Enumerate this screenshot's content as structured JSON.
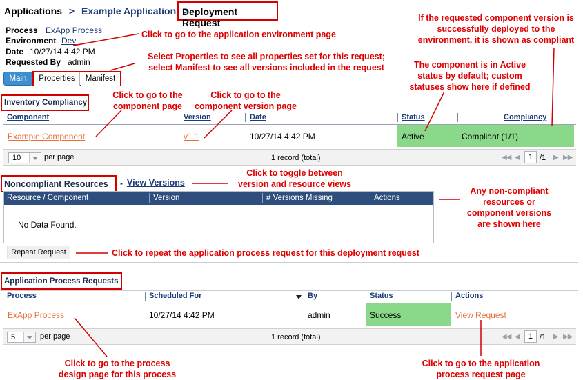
{
  "breadcrumb": {
    "applications": "Applications",
    "sep1": ">",
    "app": "Example Application",
    "sep2": ">",
    "current": "Deployment Request"
  },
  "details": {
    "process_label": "Process",
    "process_value": "ExApp Process",
    "environment_label": "Environment",
    "environment_value": "Dev",
    "date_label": "Date",
    "date_value": "10/27/14 4:42 PM",
    "requested_by_label": "Requested By",
    "requested_by_value": "admin"
  },
  "tabs": [
    {
      "label": "Main",
      "active": true
    },
    {
      "label": "Properties",
      "active": false
    },
    {
      "label": "Manifest",
      "active": false
    }
  ],
  "inventory": {
    "title": "Inventory Compliancy",
    "columns": [
      "Component",
      "Version",
      "Date",
      "Status",
      "Compliancy"
    ],
    "rows": [
      {
        "component": "Example Component",
        "version": "v1.1",
        "date": "10/27/14 4:42 PM",
        "status": "Active",
        "compliancy": "Compliant (1/1)"
      }
    ],
    "per_page_value": "10",
    "per_page_label": "per page",
    "record_count": "1 record (total)",
    "page_value": "1",
    "page_total": "/1"
  },
  "noncompliant": {
    "title": "Noncompliant Resources",
    "dash": "-",
    "view_versions": "View Versions",
    "columns": [
      "Resource / Component",
      "Version",
      "# Versions Missing",
      "Actions"
    ],
    "empty": "No Data Found."
  },
  "repeat_button": "Repeat Request",
  "process_requests": {
    "title": "Application Process Requests",
    "columns": [
      "Process",
      "Scheduled For",
      "By",
      "Status",
      "Actions"
    ],
    "rows": [
      {
        "process": "ExApp Process",
        "scheduled": "10/27/14 4:42 PM",
        "by": "admin",
        "status": "Success",
        "action": "View Request"
      }
    ],
    "per_page_value": "5",
    "per_page_label": "per page",
    "record_count": "1 record (total)",
    "page_value": "1",
    "page_total": "/1"
  },
  "annotations": {
    "env_page": "Click to go to the application environment page",
    "props": "Select Properties to see all properties set for this request;\nselect Manifest to see all versions included in the request",
    "compliant": "If the requested component version is\nsuccessfully deployed to the\nenvironment, it is shown as compliant",
    "active_status": "The component is in Active\nstatus by default; custom\nstatuses show here if defined",
    "component_page": "Click to go to the\ncomponent page",
    "version_page": "Click to go to the\ncomponent version page",
    "toggle": "Click to toggle between\nversion and resource views",
    "noncompliant_note": "Any non-compliant\nresources or\ncomponent versions\nare shown here",
    "repeat": "Click to repeat the application process request for this deployment request",
    "process_design": "Click to go to the process\ndesign page for this process",
    "request_page": "Click to go to the application\nprocess request page"
  },
  "colors": {
    "annotation": "#e00000",
    "header_navy": "#2e4e7e",
    "status_green": "#8ad88a",
    "link_orange": "#e8703a",
    "link_blue": "#1a3a78"
  }
}
